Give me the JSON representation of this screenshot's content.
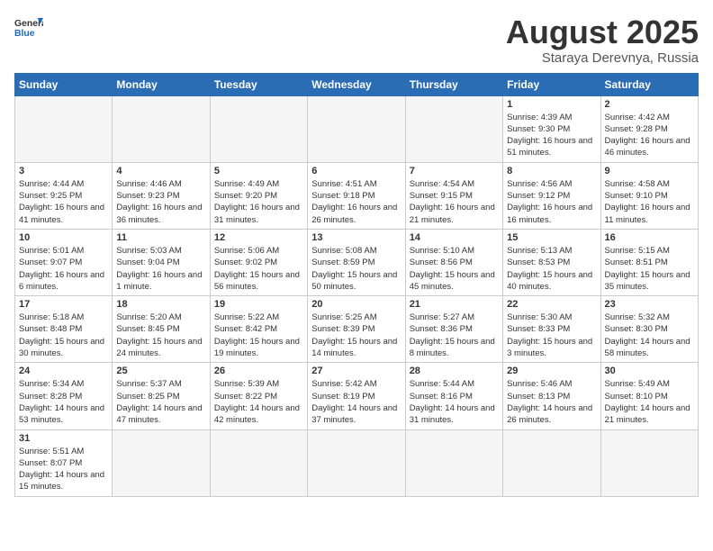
{
  "header": {
    "logo_general": "General",
    "logo_blue": "Blue",
    "title": "August 2025",
    "subtitle": "Staraya Derevnya, Russia"
  },
  "weekdays": [
    "Sunday",
    "Monday",
    "Tuesday",
    "Wednesday",
    "Thursday",
    "Friday",
    "Saturday"
  ],
  "weeks": [
    [
      {
        "day": "",
        "sunrise": "",
        "sunset": "",
        "daylight": ""
      },
      {
        "day": "",
        "sunrise": "",
        "sunset": "",
        "daylight": ""
      },
      {
        "day": "",
        "sunrise": "",
        "sunset": "",
        "daylight": ""
      },
      {
        "day": "",
        "sunrise": "",
        "sunset": "",
        "daylight": ""
      },
      {
        "day": "",
        "sunrise": "",
        "sunset": "",
        "daylight": ""
      },
      {
        "day": "1",
        "sunrise": "Sunrise: 4:39 AM",
        "sunset": "Sunset: 9:30 PM",
        "daylight": "Daylight: 16 hours and 51 minutes."
      },
      {
        "day": "2",
        "sunrise": "Sunrise: 4:42 AM",
        "sunset": "Sunset: 9:28 PM",
        "daylight": "Daylight: 16 hours and 46 minutes."
      }
    ],
    [
      {
        "day": "3",
        "sunrise": "Sunrise: 4:44 AM",
        "sunset": "Sunset: 9:25 PM",
        "daylight": "Daylight: 16 hours and 41 minutes."
      },
      {
        "day": "4",
        "sunrise": "Sunrise: 4:46 AM",
        "sunset": "Sunset: 9:23 PM",
        "daylight": "Daylight: 16 hours and 36 minutes."
      },
      {
        "day": "5",
        "sunrise": "Sunrise: 4:49 AM",
        "sunset": "Sunset: 9:20 PM",
        "daylight": "Daylight: 16 hours and 31 minutes."
      },
      {
        "day": "6",
        "sunrise": "Sunrise: 4:51 AM",
        "sunset": "Sunset: 9:18 PM",
        "daylight": "Daylight: 16 hours and 26 minutes."
      },
      {
        "day": "7",
        "sunrise": "Sunrise: 4:54 AM",
        "sunset": "Sunset: 9:15 PM",
        "daylight": "Daylight: 16 hours and 21 minutes."
      },
      {
        "day": "8",
        "sunrise": "Sunrise: 4:56 AM",
        "sunset": "Sunset: 9:12 PM",
        "daylight": "Daylight: 16 hours and 16 minutes."
      },
      {
        "day": "9",
        "sunrise": "Sunrise: 4:58 AM",
        "sunset": "Sunset: 9:10 PM",
        "daylight": "Daylight: 16 hours and 11 minutes."
      }
    ],
    [
      {
        "day": "10",
        "sunrise": "Sunrise: 5:01 AM",
        "sunset": "Sunset: 9:07 PM",
        "daylight": "Daylight: 16 hours and 6 minutes."
      },
      {
        "day": "11",
        "sunrise": "Sunrise: 5:03 AM",
        "sunset": "Sunset: 9:04 PM",
        "daylight": "Daylight: 16 hours and 1 minute."
      },
      {
        "day": "12",
        "sunrise": "Sunrise: 5:06 AM",
        "sunset": "Sunset: 9:02 PM",
        "daylight": "Daylight: 15 hours and 56 minutes."
      },
      {
        "day": "13",
        "sunrise": "Sunrise: 5:08 AM",
        "sunset": "Sunset: 8:59 PM",
        "daylight": "Daylight: 15 hours and 50 minutes."
      },
      {
        "day": "14",
        "sunrise": "Sunrise: 5:10 AM",
        "sunset": "Sunset: 8:56 PM",
        "daylight": "Daylight: 15 hours and 45 minutes."
      },
      {
        "day": "15",
        "sunrise": "Sunrise: 5:13 AM",
        "sunset": "Sunset: 8:53 PM",
        "daylight": "Daylight: 15 hours and 40 minutes."
      },
      {
        "day": "16",
        "sunrise": "Sunrise: 5:15 AM",
        "sunset": "Sunset: 8:51 PM",
        "daylight": "Daylight: 15 hours and 35 minutes."
      }
    ],
    [
      {
        "day": "17",
        "sunrise": "Sunrise: 5:18 AM",
        "sunset": "Sunset: 8:48 PM",
        "daylight": "Daylight: 15 hours and 30 minutes."
      },
      {
        "day": "18",
        "sunrise": "Sunrise: 5:20 AM",
        "sunset": "Sunset: 8:45 PM",
        "daylight": "Daylight: 15 hours and 24 minutes."
      },
      {
        "day": "19",
        "sunrise": "Sunrise: 5:22 AM",
        "sunset": "Sunset: 8:42 PM",
        "daylight": "Daylight: 15 hours and 19 minutes."
      },
      {
        "day": "20",
        "sunrise": "Sunrise: 5:25 AM",
        "sunset": "Sunset: 8:39 PM",
        "daylight": "Daylight: 15 hours and 14 minutes."
      },
      {
        "day": "21",
        "sunrise": "Sunrise: 5:27 AM",
        "sunset": "Sunset: 8:36 PM",
        "daylight": "Daylight: 15 hours and 8 minutes."
      },
      {
        "day": "22",
        "sunrise": "Sunrise: 5:30 AM",
        "sunset": "Sunset: 8:33 PM",
        "daylight": "Daylight: 15 hours and 3 minutes."
      },
      {
        "day": "23",
        "sunrise": "Sunrise: 5:32 AM",
        "sunset": "Sunset: 8:30 PM",
        "daylight": "Daylight: 14 hours and 58 minutes."
      }
    ],
    [
      {
        "day": "24",
        "sunrise": "Sunrise: 5:34 AM",
        "sunset": "Sunset: 8:28 PM",
        "daylight": "Daylight: 14 hours and 53 minutes."
      },
      {
        "day": "25",
        "sunrise": "Sunrise: 5:37 AM",
        "sunset": "Sunset: 8:25 PM",
        "daylight": "Daylight: 14 hours and 47 minutes."
      },
      {
        "day": "26",
        "sunrise": "Sunrise: 5:39 AM",
        "sunset": "Sunset: 8:22 PM",
        "daylight": "Daylight: 14 hours and 42 minutes."
      },
      {
        "day": "27",
        "sunrise": "Sunrise: 5:42 AM",
        "sunset": "Sunset: 8:19 PM",
        "daylight": "Daylight: 14 hours and 37 minutes."
      },
      {
        "day": "28",
        "sunrise": "Sunrise: 5:44 AM",
        "sunset": "Sunset: 8:16 PM",
        "daylight": "Daylight: 14 hours and 31 minutes."
      },
      {
        "day": "29",
        "sunrise": "Sunrise: 5:46 AM",
        "sunset": "Sunset: 8:13 PM",
        "daylight": "Daylight: 14 hours and 26 minutes."
      },
      {
        "day": "30",
        "sunrise": "Sunrise: 5:49 AM",
        "sunset": "Sunset: 8:10 PM",
        "daylight": "Daylight: 14 hours and 21 minutes."
      }
    ],
    [
      {
        "day": "31",
        "sunrise": "Sunrise: 5:51 AM",
        "sunset": "Sunset: 8:07 PM",
        "daylight": "Daylight: 14 hours and 15 minutes."
      },
      {
        "day": "",
        "sunrise": "",
        "sunset": "",
        "daylight": ""
      },
      {
        "day": "",
        "sunrise": "",
        "sunset": "",
        "daylight": ""
      },
      {
        "day": "",
        "sunrise": "",
        "sunset": "",
        "daylight": ""
      },
      {
        "day": "",
        "sunrise": "",
        "sunset": "",
        "daylight": ""
      },
      {
        "day": "",
        "sunrise": "",
        "sunset": "",
        "daylight": ""
      },
      {
        "day": "",
        "sunrise": "",
        "sunset": "",
        "daylight": ""
      }
    ]
  ]
}
